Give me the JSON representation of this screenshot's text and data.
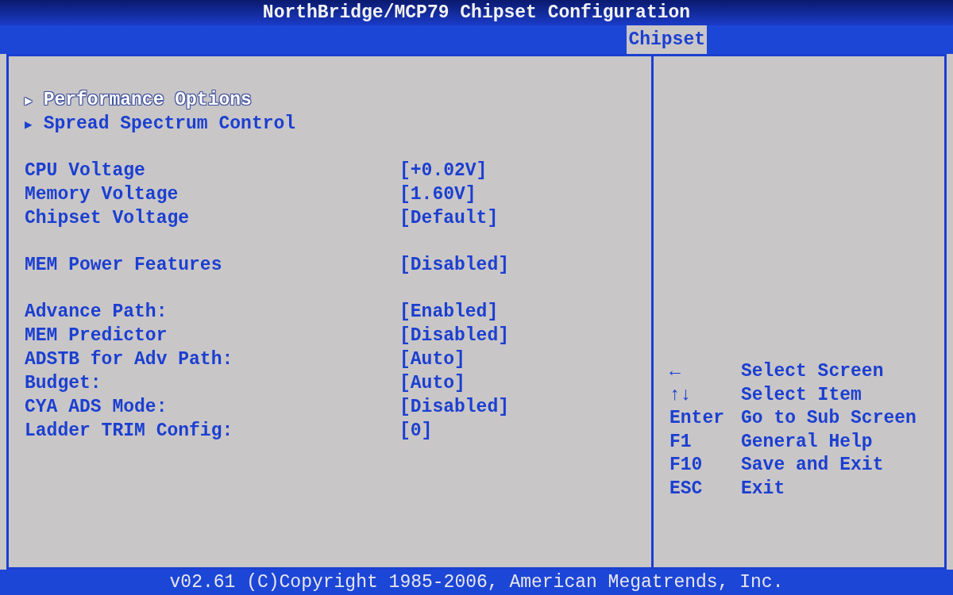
{
  "window": {
    "title": "NorthBridge/MCP79 Chipset Configuration"
  },
  "tabs": [
    {
      "label": "Chipset",
      "selected": true
    }
  ],
  "groups": [
    {
      "items": [
        {
          "kind": "submenu",
          "marker": "▶",
          "label": "Performance Options",
          "selected": true
        },
        {
          "kind": "submenu",
          "marker": "▶",
          "label": "Spread Spectrum Control",
          "selected": false
        }
      ]
    },
    {
      "items": [
        {
          "kind": "setting",
          "label": "CPU Voltage",
          "value": "[+0.02V]",
          "selected": false
        },
        {
          "kind": "setting",
          "label": "Memory Voltage",
          "value": "[1.60V]",
          "selected": false
        },
        {
          "kind": "setting",
          "label": "Chipset Voltage",
          "value": "[Default]",
          "selected": false
        }
      ]
    },
    {
      "items": [
        {
          "kind": "setting",
          "label": "MEM Power Features",
          "value": "[Disabled]",
          "selected": false
        }
      ]
    },
    {
      "items": [
        {
          "kind": "setting",
          "label": "Advance Path:",
          "value": "[Enabled]",
          "selected": false
        },
        {
          "kind": "setting",
          "label": "MEM Predictor",
          "value": "[Disabled]",
          "selected": false
        },
        {
          "kind": "setting",
          "label": "ADSTB for Adv Path:",
          "value": "[Auto]",
          "selected": false
        },
        {
          "kind": "setting",
          "label": "Budget:",
          "value": "[Auto]",
          "selected": false
        },
        {
          "kind": "setting",
          "label": "CYA ADS Mode:",
          "value": "[Disabled]",
          "selected": false
        },
        {
          "kind": "setting",
          "label": "Ladder TRIM Config:",
          "value": "[0]",
          "selected": false
        }
      ]
    }
  ],
  "help": [
    {
      "key": "←",
      "action": "Select Screen"
    },
    {
      "key": "↑↓",
      "action": "Select Item"
    },
    {
      "key": "Enter",
      "action": "Go to Sub Screen"
    },
    {
      "key": "F1",
      "action": "General Help"
    },
    {
      "key": "F10",
      "action": "Save and Exit"
    },
    {
      "key": "ESC",
      "action": "Exit"
    }
  ],
  "status_bar": {
    "text": "v02.61 (C)Copyright 1985-2006, American Megatrends, Inc."
  }
}
